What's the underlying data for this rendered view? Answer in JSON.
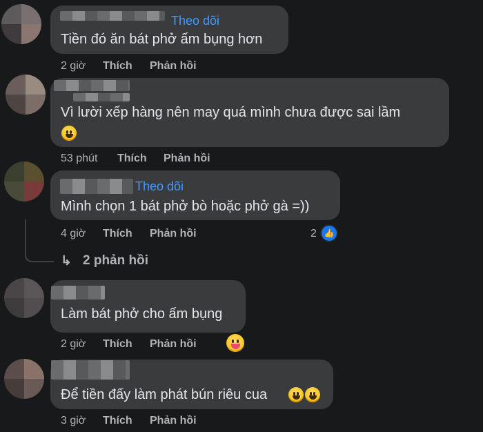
{
  "comments": [
    {
      "follow": "Theo dõi",
      "text": "Tiền đó ăn bát phở ấm bụng hơn",
      "time": "2 giờ",
      "like": "Thích",
      "reply": "Phản hồi"
    },
    {
      "follow": "",
      "text_line1": "Vì lười xếp hàng nên may quá mình chưa được sai lầm",
      "time": "53 phút",
      "like": "Thích",
      "reply": "Phản hồi"
    },
    {
      "follow": "Theo dõi",
      "text": "Mình chọn 1 bát phở bò hoặc phở gà =))",
      "time": "4 giờ",
      "like": "Thích",
      "reply": "Phản hồi",
      "reaction_count": "2",
      "replies_link": "2 phản hồi"
    },
    {
      "text": "Làm bát phở cho ấm bụng",
      "time": "2 giờ",
      "like": "Thích",
      "reply": "Phản hồi"
    },
    {
      "text": "Để tiền đấy làm phát bún riêu cua",
      "time": "3 giờ",
      "like": "Thích",
      "reply": "Phản hồi"
    }
  ],
  "icons": {
    "like": "thumbs-up-icon",
    "reply_arrow": "reply-arrow-icon",
    "emoji_grin": "grinning-squinting-emoji",
    "emoji_tongue": "winking-tongue-emoji",
    "emoji_smile": "grinning-emoji"
  },
  "colors": {
    "background": "#18191a",
    "bubble": "#3a3b3c",
    "link": "#4599ff",
    "like": "#1877f2"
  }
}
